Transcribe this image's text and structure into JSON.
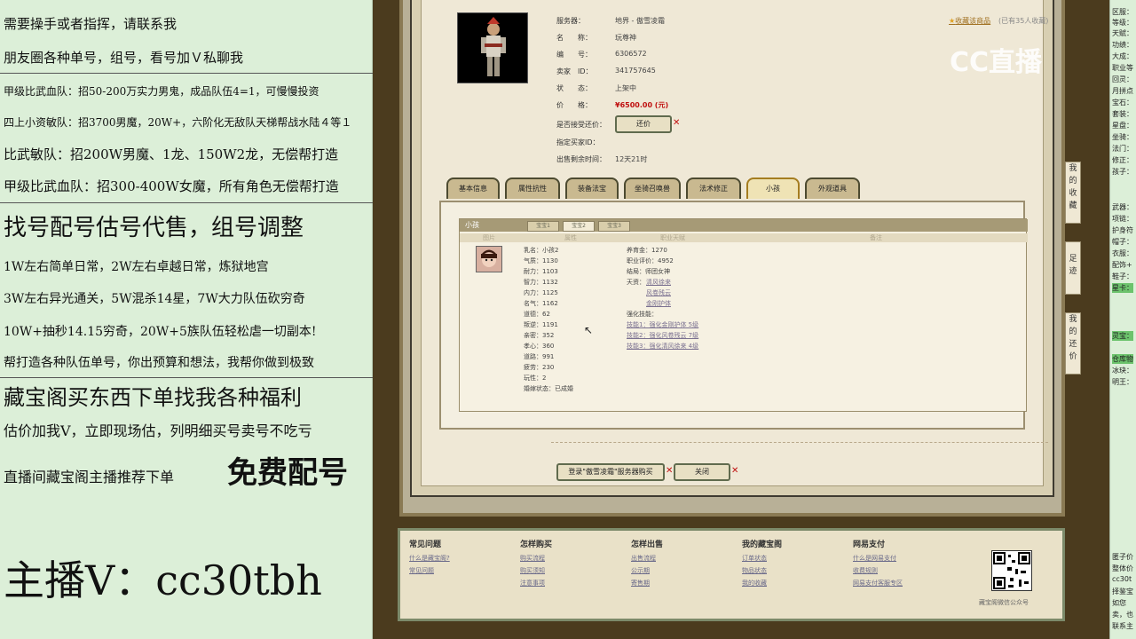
{
  "left": {
    "lines": [
      "需要操手或者指挥，请联系我",
      "朋友圈各种单号，组号，看号加Ｖ私聊我",
      "甲级比武血队：招50-200万实力男鬼，成品队伍4=1，可慢慢投资",
      "四上小资敏队：招3700男魔，20W+，六阶化无敌队天梯帮战水陆４等１",
      "比武敏队：招200W男魔、1龙、150W2龙，无偿帮打造",
      "甲级比武血队：招300-400W女魔，所有角色无偿帮打造",
      "找号配号估号代售，组号调整",
      "1W左右简单日常，2W左右卓越日常，炼狱地宫",
      "3W左右异光通关，5W混杀14星，7W大力队伍砍穷奇",
      "10W+抽秒14.15穷奇，20W+5族队伍轻松虐一切副本!",
      "帮打造各种队伍单号，你出预算和想法，我帮你做到极致",
      "藏宝阁买东西下单找我各种福利",
      "估价加我V，立即现场估，列明细买号卖号不吃亏",
      "直播间藏宝阁主播推荐下单",
      "免费配号",
      "主播V：cc30tbh"
    ]
  },
  "logo": "CC直播",
  "item": {
    "fav_link": "收藏该商品",
    "fav_count": "(已有35人收藏)",
    "labels": {
      "server": "服务器：",
      "name": "名　　称：",
      "id": "编　　号：",
      "seller": "卖家　ID：",
      "status": "状　　态：",
      "price": "价　　格：",
      "bargain": "是否接受还价：",
      "buyer": "指定买家ID：",
      "time_left": "出售剩余时间："
    },
    "server": "地界 - 傲雪凌霜",
    "name": "玩尊神",
    "id": "6306572",
    "seller": "341757645",
    "status": "上架中",
    "price": "¥6500.00 (元)",
    "bargain_btn": "还价",
    "time_left": "12天21时"
  },
  "tabs": [
    "基本信息",
    "属性抗性",
    "装备法宝",
    "坐骑召唤兽",
    "法术修正",
    "小孩",
    "外观道具"
  ],
  "kids_panel": {
    "title": "小孩",
    "subtabs": [
      "宝宝1",
      "宝宝2",
      "宝宝3"
    ],
    "cols": [
      "图片",
      "属性",
      "职业天赋",
      "备注"
    ],
    "attrs": [
      "乳名：小孩2",
      "气质：1130",
      "耐力：1103",
      "智力：1132",
      "内力：1125",
      "名气：1162",
      "道德：62",
      "叛逆：1191",
      "亲密：352",
      "孝心：360",
      "道路：991",
      "疲劳：230",
      "玩性：2",
      "婚嫁状态：已成婚"
    ],
    "info": [
      "养育金：1270",
      "职业评价：4952",
      "结局：师团女神",
      "天资："
    ],
    "talents": [
      "清风徐来",
      "风卷残云",
      "金刚护体"
    ],
    "enhance_title": "强化技能：",
    "enhance": [
      "技能1：强化金刚护体 5级",
      "技能2：强化风卷残云 7级",
      "技能3：强化清风徐来 4级"
    ]
  },
  "buttons": {
    "login": "登录\"傲雪凌霜\"服务器购买",
    "close": "关闭"
  },
  "footer": {
    "cols": [
      {
        "title": "常见问题",
        "links": [
          "什么是藏宝阁?",
          "常见问题"
        ]
      },
      {
        "title": "怎样购买",
        "links": [
          "购买流程",
          "购买须知",
          "注意事项"
        ]
      },
      {
        "title": "怎样出售",
        "links": [
          "出售流程",
          "公示期",
          "寄售期"
        ]
      },
      {
        "title": "我的藏宝阁",
        "links": [
          "订单状态",
          "物品状态",
          "我的收藏"
        ]
      },
      {
        "title": "网易支付",
        "links": [
          "什么是网易支付",
          "收费规则",
          "网易支付客服专区"
        ]
      }
    ],
    "qr_caption": "藏宝阁微信公众号"
  },
  "side": [
    "我的收藏",
    "足迹",
    "我的还价"
  ],
  "right": {
    "lines": [
      "区服：",
      "等级：",
      "天赋：",
      "功绩：",
      "大成：",
      "职业等",
      "回灵：",
      "月拼点",
      "宝石：",
      "套装：",
      "星盘：",
      "坐骑：",
      "法门：",
      "修正：",
      "孩子：",
      "武器：",
      "项链：",
      "护身符",
      "帽子：",
      "衣服：",
      "配饰+",
      "鞋子：",
      "星卡：",
      "灵宝：",
      "仓库物",
      "冰玦：",
      "明王：",
      "匿子价",
      "整体价",
      "cc30t",
      "择鉴宝",
      "如您",
      "卖，也",
      "联系主"
    ]
  }
}
